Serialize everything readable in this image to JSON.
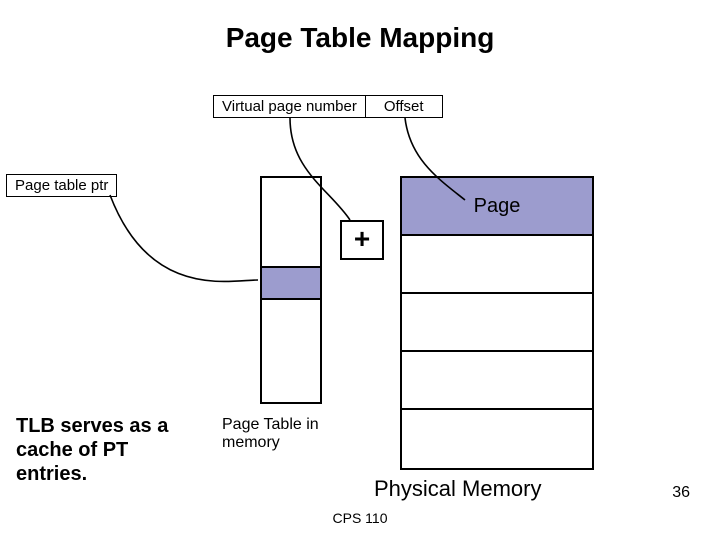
{
  "title": "Page Table Mapping",
  "virtual_address": {
    "vpn_label": "Virtual page number",
    "offset_label": "Offset"
  },
  "page_table_ptr_label": "Page table ptr",
  "plus_symbol": "+",
  "physical_memory": {
    "page_label": "Page",
    "caption": "Physical Memory"
  },
  "page_table_caption": "Page Table in memory",
  "tlb_text": "TLB serves as a cache of PT entries.",
  "footer_course": "CPS 110",
  "slide_number": "36"
}
